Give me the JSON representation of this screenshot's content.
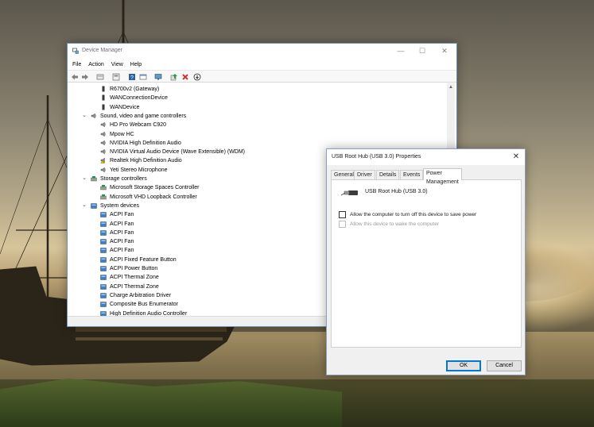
{
  "device_manager": {
    "title": "Device Manager",
    "menu": [
      "File",
      "Action",
      "View",
      "Help"
    ],
    "toolbar_icons": [
      "back-icon",
      "forward-icon",
      "properties-icon",
      "show-hidden-icon",
      "help-icon",
      "view-icon",
      "monitor-icon",
      "update-driver-icon",
      "uninstall-icon",
      "scan-hardware-icon"
    ],
    "tree": [
      {
        "label": "R6700v2 (Gateway)",
        "level": 2,
        "icon": "device-icon"
      },
      {
        "label": "WANConnectionDevice",
        "level": 2,
        "icon": "device-icon"
      },
      {
        "label": "WANDevice",
        "level": 2,
        "icon": "device-icon"
      },
      {
        "label": "Sound, video and game controllers",
        "level": 1,
        "icon": "speaker-icon",
        "expanded": true
      },
      {
        "label": "HD Pro Webcam C920",
        "level": 2,
        "icon": "speaker-icon"
      },
      {
        "label": "Mpow HC",
        "level": 2,
        "icon": "speaker-icon"
      },
      {
        "label": "NVIDIA High Definition Audio",
        "level": 2,
        "icon": "speaker-icon"
      },
      {
        "label": "NVIDIA Virtual Audio Device (Wave Extensible) (WDM)",
        "level": 2,
        "icon": "speaker-icon"
      },
      {
        "label": "Realtek High Definition Audio",
        "level": 2,
        "icon": "warning-speaker-icon"
      },
      {
        "label": "Yeti Stereo Microphone",
        "level": 2,
        "icon": "speaker-icon"
      },
      {
        "label": "Storage controllers",
        "level": 1,
        "icon": "storage-icon",
        "expanded": true
      },
      {
        "label": "Microsoft Storage Spaces Controller",
        "level": 2,
        "icon": "storage-icon"
      },
      {
        "label": "Microsoft VHD Loopback Controller",
        "level": 2,
        "icon": "storage-icon"
      },
      {
        "label": "System devices",
        "level": 1,
        "icon": "system-folder-icon",
        "expanded": true
      },
      {
        "label": "ACPI Fan",
        "level": 2,
        "icon": "system-device-icon"
      },
      {
        "label": "ACPI Fan",
        "level": 2,
        "icon": "system-device-icon"
      },
      {
        "label": "ACPI Fan",
        "level": 2,
        "icon": "system-device-icon"
      },
      {
        "label": "ACPI Fan",
        "level": 2,
        "icon": "system-device-icon"
      },
      {
        "label": "ACPI Fan",
        "level": 2,
        "icon": "system-device-icon"
      },
      {
        "label": "ACPI Fixed Feature Button",
        "level": 2,
        "icon": "system-device-icon"
      },
      {
        "label": "ACPI Power Button",
        "level": 2,
        "icon": "system-device-icon"
      },
      {
        "label": "ACPI Thermal Zone",
        "level": 2,
        "icon": "system-device-icon"
      },
      {
        "label": "ACPI Thermal Zone",
        "level": 2,
        "icon": "system-device-icon"
      },
      {
        "label": "Charge Arbitration Driver",
        "level": 2,
        "icon": "system-device-icon"
      },
      {
        "label": "Composite Bus Enumerator",
        "level": 2,
        "icon": "system-device-icon"
      },
      {
        "label": "High Definition Audio Controller",
        "level": 2,
        "icon": "system-device-icon"
      }
    ]
  },
  "properties_dialog": {
    "title": "USB Root Hub (USB 3.0) Properties",
    "tabs": [
      "General",
      "Driver",
      "Details",
      "Events",
      "Power Management"
    ],
    "active_tab": "Power Management",
    "device_name": "USB Root Hub (USB 3.0)",
    "device_icon": "usb-plug-icon",
    "options": [
      {
        "label": "Allow the computer to turn off this device to save power",
        "checked": false,
        "enabled": true
      },
      {
        "label": "Allow this device to wake the computer",
        "checked": false,
        "enabled": false
      }
    ],
    "ok_label": "OK",
    "cancel_label": "Cancel"
  },
  "colors": {
    "accent": "#0078d7",
    "window_border": "#6f8fb3",
    "dialog_bg": "#f0f0f0"
  }
}
